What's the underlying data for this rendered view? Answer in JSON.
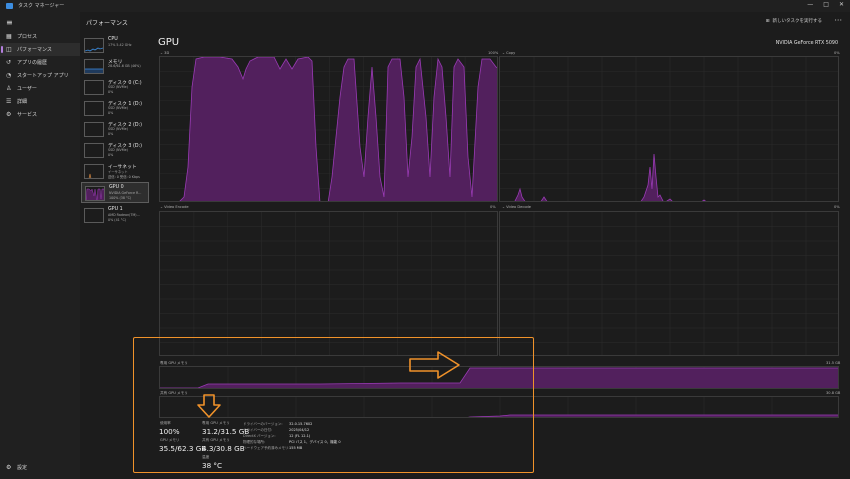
{
  "window": {
    "title": "タスク マネージャー",
    "buttons": [
      "—",
      "□",
      "✕"
    ]
  },
  "sidebar": {
    "items": [
      {
        "icon": "grid-icon",
        "label": "プロセス"
      },
      {
        "icon": "performance-icon",
        "label": "パフォーマンス",
        "active": true
      },
      {
        "icon": "history-icon",
        "label": "アプリの履歴"
      },
      {
        "icon": "startup-icon",
        "label": "スタートアップ アプリ"
      },
      {
        "icon": "users-icon",
        "label": "ユーザー"
      },
      {
        "icon": "details-icon",
        "label": "詳細"
      },
      {
        "icon": "services-icon",
        "label": "サービス"
      }
    ],
    "settings_label": "設定"
  },
  "header": {
    "title": "パフォーマンス",
    "new_task_label": "新しいタスクを実行する"
  },
  "devices": [
    {
      "name": "CPU",
      "sub1": "17% 5.42 GHz",
      "sub2": ""
    },
    {
      "name": "メモリ",
      "sub1": "28.6/61.6 GB (46%)",
      "sub2": ""
    },
    {
      "name": "ディスク 0 (C:)",
      "sub1": "SSD (NVMe)",
      "sub2": "0%"
    },
    {
      "name": "ディスク 1 (D:)",
      "sub1": "SSD (NVMe)",
      "sub2": "0%"
    },
    {
      "name": "ディスク 2 (D:)",
      "sub1": "SSD (NVMe)",
      "sub2": "0%"
    },
    {
      "name": "ディスク 3 (D:)",
      "sub1": "SSD (NVMe)",
      "sub2": "0%"
    },
    {
      "name": "イーサネット",
      "sub1": "イーサネット",
      "sub2": "送信: 0 受信: 0 Kbps"
    },
    {
      "name": "GPU 0",
      "sub1": "NVIDIA GeForce R...",
      "sub2": "100% (38 °C)",
      "active": true
    },
    {
      "name": "GPU 1",
      "sub1": "AMD Radeon(TM)...",
      "sub2": "0% (41 °C)"
    }
  ],
  "gpu": {
    "title": "GPU",
    "model": "NVIDIA GeForce RTX 5090",
    "engines": [
      {
        "label": "3D",
        "pct": "100%"
      },
      {
        "label": "Copy",
        "pct": "0%"
      },
      {
        "label": "Video Encode",
        "pct": "0%"
      },
      {
        "label": "Video Decode",
        "pct": "0%"
      }
    ],
    "dedicated_label": "専用 GPU メモリ",
    "dedicated_max": "31.5 GB",
    "shared_label": "共有 GPU メモリ",
    "shared_max": "30.8 GB",
    "stats": {
      "usage_label": "使用率",
      "usage_value": "100%",
      "dedicated_label": "専用 GPU メモリ",
      "dedicated_value": "31.2/31.5 GB",
      "gpu_mem_label": "GPU メモリ",
      "gpu_mem_value": "35.5/62.3 GB",
      "shared_label": "共有 GPU メモリ",
      "shared_value": "4.3/30.8 GB",
      "temp_label": "温度",
      "temp_value": "38 °C"
    },
    "info": [
      {
        "k": "ドライバーのバージョン:",
        "v": "32.0.15.7602"
      },
      {
        "k": "ドライバーの日付:",
        "v": "2025/04/12"
      },
      {
        "k": "DirectX バージョン:",
        "v": "12 (FL 12.1)"
      },
      {
        "k": "物理的な場所:",
        "v": "PCI バス 1、デバイス 0、機能 0"
      },
      {
        "k": "ハードウェア予約済みメモリ:",
        "v": "155 MB"
      }
    ]
  },
  "colors": {
    "accent": "#b580e0",
    "graph_line": "#9a3bb5",
    "graph_fill": "#52205d",
    "annotation": "#f0922a"
  }
}
